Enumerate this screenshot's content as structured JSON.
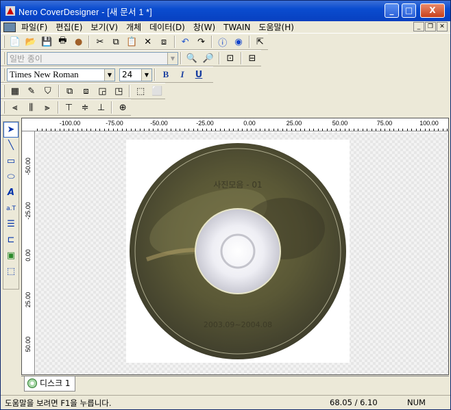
{
  "window": {
    "title": "Nero CoverDesigner - [새 문서 1 *]",
    "minimize": "_",
    "maximize": "□",
    "close": "X"
  },
  "menu": [
    "파일(F)",
    "편집(E)",
    "보기(V)",
    "개체",
    "데이터(D)",
    "창(W)",
    "TWAIN",
    "도움말(H)"
  ],
  "paper_combo": {
    "value": "일반 종이"
  },
  "font_combo": {
    "value": "Times New Roman"
  },
  "size_combo": {
    "value": "24"
  },
  "format": {
    "bold": "B",
    "italic": "I",
    "underline": "U"
  },
  "ruler_h": [
    "-100.00",
    "-75.00",
    "-50.00",
    "-25.00",
    "0.00",
    "25.00",
    "50.00",
    "75.00",
    "100.00"
  ],
  "ruler_v": [
    "-50.00",
    "-25.00",
    "0.00",
    "25.00",
    "50.00"
  ],
  "disc": {
    "label_top": "사진모음 - 01",
    "label_bottom": "2003.09~2004.08"
  },
  "tab": {
    "label": "디스크 1"
  },
  "status": {
    "help": "도움말을 보려면 F1을 누릅니다.",
    "coords": "68.05 / 6.10",
    "num": "NUM"
  }
}
